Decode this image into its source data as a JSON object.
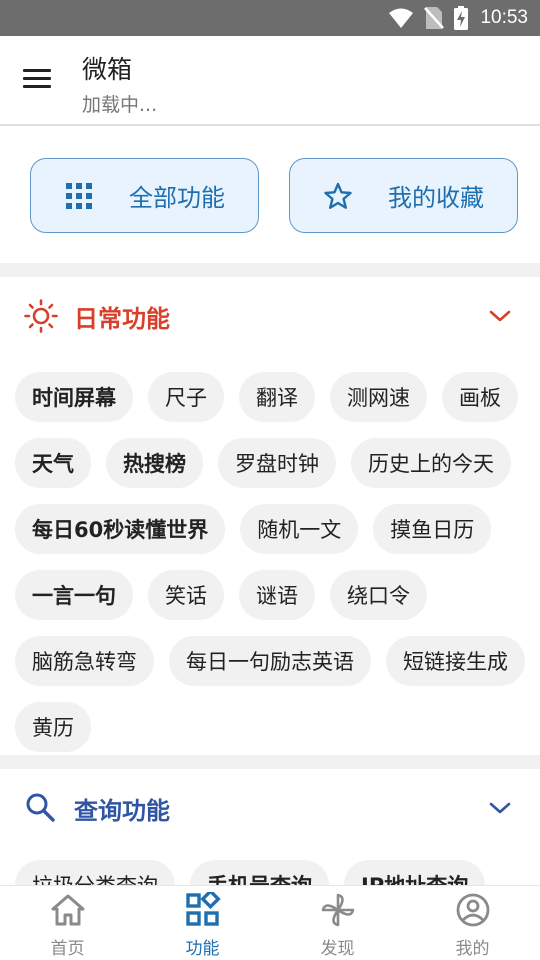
{
  "status_bar": {
    "time": "10:53"
  },
  "app_bar": {
    "title": "微箱",
    "subtitle": "加载中..."
  },
  "quick_actions": [
    {
      "label": "全部功能",
      "icon": "grid-icon"
    },
    {
      "label": "我的收藏",
      "icon": "star-icon"
    }
  ],
  "sections": [
    {
      "title": "日常功能",
      "icon": "sun-icon",
      "color": "#d9402b",
      "expanded": true,
      "chips": [
        {
          "label": "时间屏幕",
          "bold": true
        },
        {
          "label": "尺子",
          "bold": false
        },
        {
          "label": "翻译",
          "bold": false
        },
        {
          "label": "测网速",
          "bold": false
        },
        {
          "label": "画板",
          "bold": false
        },
        {
          "label": "天气",
          "bold": true
        },
        {
          "label": "热搜榜",
          "bold": true
        },
        {
          "label": "罗盘时钟",
          "bold": false
        },
        {
          "label": "历史上的今天",
          "bold": false
        },
        {
          "label": "每日60秒读懂世界",
          "bold": true
        },
        {
          "label": "随机一文",
          "bold": false
        },
        {
          "label": "摸鱼日历",
          "bold": false
        },
        {
          "label": "一言一句",
          "bold": true
        },
        {
          "label": "笑话",
          "bold": false
        },
        {
          "label": "谜语",
          "bold": false
        },
        {
          "label": "绕口令",
          "bold": false
        },
        {
          "label": "脑筋急转弯",
          "bold": false
        },
        {
          "label": "每日一句励志英语",
          "bold": false
        },
        {
          "label": "短链接生成",
          "bold": false
        },
        {
          "label": "黄历",
          "bold": false
        }
      ]
    },
    {
      "title": "查询功能",
      "icon": "search-icon",
      "color": "#2f55a4",
      "expanded": true,
      "chips": [
        {
          "label": "垃圾分类查询",
          "bold": false
        },
        {
          "label": "手机号查询",
          "bold": true
        },
        {
          "label": "IP地址查询",
          "bold": true
        }
      ]
    }
  ],
  "bottom_nav": [
    {
      "label": "首页",
      "icon": "home-icon",
      "active": false
    },
    {
      "label": "功能",
      "icon": "apps-icon",
      "active": true
    },
    {
      "label": "发现",
      "icon": "pinwheel-icon",
      "active": false
    },
    {
      "label": "我的",
      "icon": "profile-icon",
      "active": false
    }
  ],
  "colors": {
    "accent": "#1f6fb0",
    "quick_bg": "#e8f3fd",
    "quick_border": "#5f98c8",
    "chip_bg": "#f1f1f1"
  }
}
